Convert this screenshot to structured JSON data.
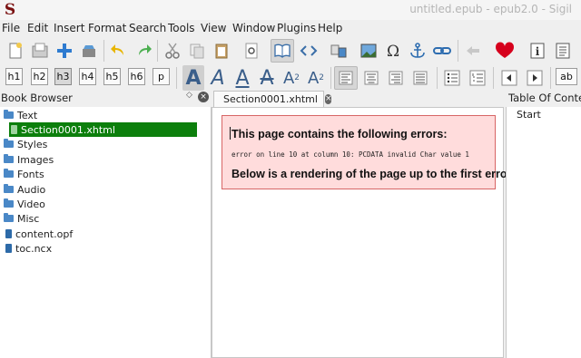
{
  "window": {
    "title": "untitled.epub - epub2.0 - Sigil",
    "logo_letter": "S"
  },
  "menu": [
    "File",
    "Edit",
    "Insert",
    "Format",
    "Search",
    "Tools",
    "View",
    "Window",
    "Plugins",
    "Help"
  ],
  "toolbar_top": {
    "icons": [
      "new-file-icon",
      "open-file-icon",
      "add-file-icon",
      "save-file-icon",
      "undo-icon",
      "redo-icon",
      "cut-icon",
      "copy-icon",
      "paste-icon",
      "preview-icon",
      "book-view-icon",
      "code-view-icon",
      "split-icon",
      "insert-image-icon",
      "special-character-icon",
      "anchor-icon",
      "link-icon",
      "back-arrow-icon",
      "heart-icon",
      "metadata-editor-icon",
      "table-of-contents-icon"
    ]
  },
  "toolbar_bottom": {
    "headings": [
      "h1",
      "h2",
      "h3",
      "h4",
      "h5",
      "h6",
      "p"
    ],
    "selected_heading": "h3",
    "format_letter": "A",
    "subscript_base": "A",
    "subscript_mark": "2",
    "superscript_base": "A",
    "superscript_mark": "2",
    "case_label": "ab"
  },
  "book_browser": {
    "title": "Book Browser",
    "items": [
      {
        "label": "Text",
        "type": "folder"
      },
      {
        "label": "Section0001.xhtml",
        "type": "file",
        "selected": true
      },
      {
        "label": "Styles",
        "type": "folder"
      },
      {
        "label": "Images",
        "type": "folder"
      },
      {
        "label": "Fonts",
        "type": "folder"
      },
      {
        "label": "Audio",
        "type": "folder"
      },
      {
        "label": "Video",
        "type": "folder"
      },
      {
        "label": "Misc",
        "type": "folder"
      },
      {
        "label": "content.opf",
        "type": "file"
      },
      {
        "label": "toc.ncx",
        "type": "file"
      }
    ]
  },
  "editor": {
    "tab_label": "Section0001.xhtml",
    "error_heading": "This page contains the following errors:",
    "error_message": "error on line 10 at column 10: PCDATA invalid Char value 1",
    "rendering_note": "Below is a rendering of the page up to the first error."
  },
  "toc": {
    "title": "Table Of Contents",
    "items": [
      "Start"
    ]
  },
  "colors": {
    "selection": "#0c7f0c",
    "error_bg": "#ffdcdc",
    "error_border": "#d76565",
    "folder": "#4a88c7"
  }
}
